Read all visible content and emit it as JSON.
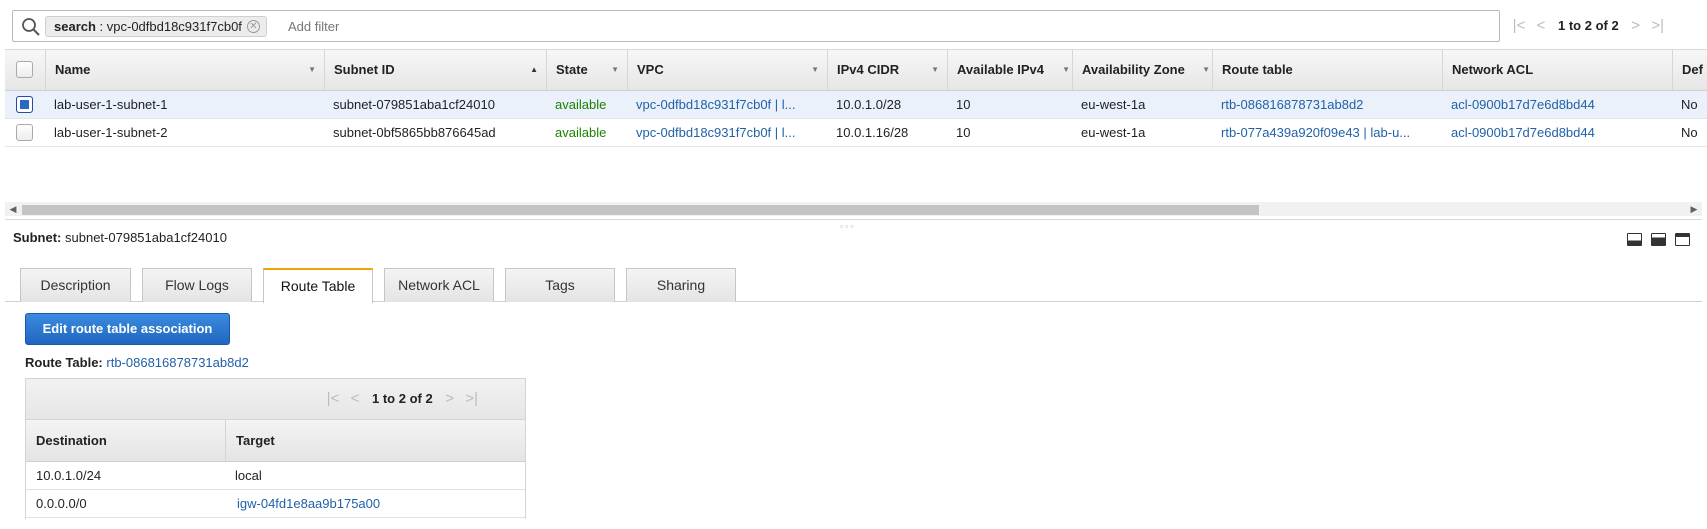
{
  "filter": {
    "token_key": "search",
    "token_value": " : vpc-0dfbd18c931f7cb0f",
    "add_filter_placeholder": "Add filter"
  },
  "pager_top": {
    "text": "1 to 2 of 2"
  },
  "subnets_table": {
    "columns": [
      "Name",
      "Subnet ID",
      "State",
      "VPC",
      "IPv4 CIDR",
      "Available IPv4",
      "Availability Zone",
      "Route table",
      "Network ACL",
      "Def"
    ],
    "rows": [
      {
        "selected": true,
        "name": "lab-user-1-subnet-1",
        "subnet_id": "subnet-079851aba1cf24010",
        "state": "available",
        "vpc": "vpc-0dfbd18c931f7cb0f | l...",
        "cidr": "10.0.1.0/28",
        "available_ipv4": "10",
        "az": "eu-west-1a",
        "route_table": "rtb-086816878731ab8d2",
        "network_acl": "acl-0900b17d7e6d8bd44",
        "default": "No"
      },
      {
        "selected": false,
        "name": "lab-user-1-subnet-2",
        "subnet_id": "subnet-0bf5865bb876645ad",
        "state": "available",
        "vpc": "vpc-0dfbd18c931f7cb0f | l...",
        "cidr": "10.0.1.16/28",
        "available_ipv4": "10",
        "az": "eu-west-1a",
        "route_table": "rtb-077a439a920f09e43 | lab-u...",
        "network_acl": "acl-0900b17d7e6d8bd44",
        "default": "No"
      }
    ]
  },
  "details": {
    "subnet_label": "Subnet:",
    "subnet_value": "subnet-079851aba1cf24010",
    "tabs": [
      "Description",
      "Flow Logs",
      "Route Table",
      "Network ACL",
      "Tags",
      "Sharing"
    ],
    "active_tab": "Route Table",
    "edit_button": "Edit route table association",
    "route_table_label": "Route Table:",
    "route_table_value": "rtb-086816878731ab8d2",
    "pager_text": "1 to 2 of 2",
    "routes_columns": [
      "Destination",
      "Target"
    ],
    "routes": [
      {
        "destination": "10.0.1.0/24",
        "target": "local"
      },
      {
        "destination": "0.0.0.0/0",
        "target": "igw-04fd1e8aa9b175a00"
      }
    ]
  },
  "colors": {
    "link": "#2261a8",
    "state_available": "#1d8102",
    "primary_button": "#1f66c0",
    "active_tab_accent": "#f0a30a",
    "selected_row": "#eaf1fb"
  }
}
